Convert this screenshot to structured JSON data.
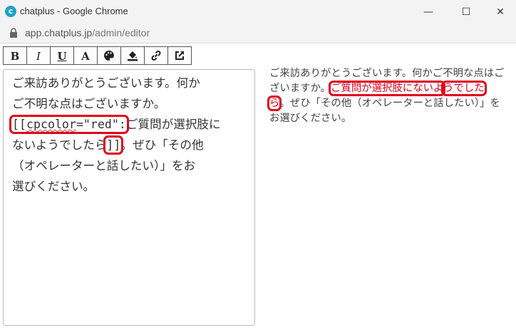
{
  "window": {
    "title": "chatplus - Google Chrome",
    "icon": "chatplus-logo-icon",
    "buttons": {
      "minimize": "—",
      "maximize": "☐",
      "close": "✕"
    }
  },
  "address": {
    "host": "app.chatplus.jp",
    "path": "/admin/editor"
  },
  "toolbar": {
    "bold": "B",
    "italic": "I",
    "underline": "U",
    "text": "A"
  },
  "editor": {
    "lines": [
      "ご来訪ありがとうございます。何か",
      "ご不明な点はございますか。",
      "",
      "ないようでしたら",
      "（オペレーターと話したい）」をお",
      "選びください。"
    ],
    "tag_open_bracket": "[[",
    "tag_attr": "cpcolor",
    "tag_value": "=\"red\"",
    "tag_colon": ":",
    "line3_rest": "ご質問が選択肢に",
    "tag_close": "]]",
    "line4_rest": "。ぜひ「その他"
  },
  "preview": {
    "before": "ご来訪ありがとうございます。何かご不明な点はございますか。",
    "red_part1": "ご質問が選択肢にないよ",
    "red_part2": "うでしたら",
    "after": "。ぜひ「その他（オペレーターと話したい）」をお選びください。"
  },
  "colors": {
    "highlight": "#e0001b",
    "red_text": "#e0001b"
  }
}
